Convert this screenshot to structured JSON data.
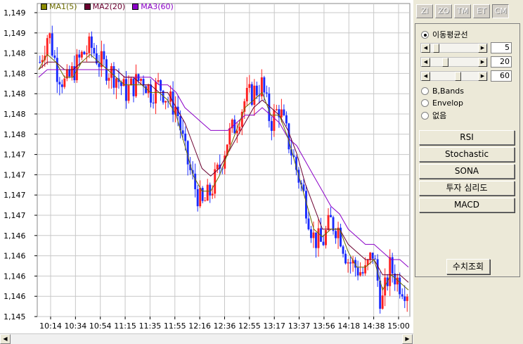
{
  "colors": {
    "up_candle": "#ff2020",
    "down_candle": "#1a2bff",
    "ma1": "#6b6b00",
    "ma2": "#6b0030",
    "ma3": "#8b00c8",
    "grid": "#c8c8c8"
  },
  "legend": [
    {
      "label": "MA1(5)",
      "color": "#8b8b00"
    },
    {
      "label": "MA2(20)",
      "color": "#6b0030"
    },
    {
      "label": "MA3(60)",
      "color": "#8b00c8"
    }
  ],
  "toolbar": {
    "buttons": [
      "ZI",
      "ZO",
      "TM",
      "ET",
      "CM"
    ],
    "active": "CM"
  },
  "settings": {
    "ma_radio_label": "이동평균선",
    "sliders": [
      {
        "value": "5",
        "position": 0.05
      },
      {
        "value": "20",
        "position": 0.28
      },
      {
        "value": "60",
        "position": 0.58
      }
    ],
    "bbands_label": "B,Bands",
    "envelop_label": "Envelop",
    "none_label": "없음",
    "indicator_buttons": [
      "RSI",
      "Stochastic",
      "SONA",
      "투자 심리도",
      "MACD"
    ],
    "query_button": "수치조회"
  },
  "chart_data": {
    "type": "candlestick",
    "y_tick_labels": [
      "1,149",
      "1,149",
      "1,148",
      "1,148",
      "1,148",
      "1,148",
      "1,148",
      "1,147",
      "1,147",
      "1,147",
      "1,147",
      "1,146",
      "1,146",
      "1,146",
      "1,146",
      "1,145"
    ],
    "x_tick_labels": [
      "10:14",
      "10:34",
      "10:54",
      "11:15",
      "11:35",
      "11:55",
      "12:16",
      "12:36",
      "12:55",
      "13:17",
      "13:37",
      "13:56",
      "14:18",
      "14:38",
      "15:00"
    ],
    "ylim": [
      1145.35,
      1149.35
    ],
    "price_path": [
      1148.7,
      1149.1,
      1148.6,
      1148.4,
      1148.6,
      1148.8,
      1148.9,
      1148.7,
      1148.6,
      1148.5,
      1148.3,
      1148.4,
      1148.5,
      1148.3,
      1148.4,
      1148.2,
      1148.1,
      1147.5,
      1147.1,
      1146.8,
      1147.0,
      1147.3,
      1147.7,
      1147.9,
      1148.2,
      1148.3,
      1148.4,
      1147.9,
      1148.1,
      1147.7,
      1147.3,
      1146.9,
      1146.4,
      1146.3,
      1146.6,
      1146.5,
      1146.1,
      1146.0,
      1145.9,
      1146.2,
      1145.5,
      1146.0,
      1145.8,
      1145.7
    ],
    "ma1": [
      1148.6,
      1148.8,
      1148.7,
      1148.5,
      1148.5,
      1148.7,
      1148.8,
      1148.7,
      1148.6,
      1148.5,
      1148.4,
      1148.4,
      1148.4,
      1148.3,
      1148.3,
      1148.2,
      1148.0,
      1147.6,
      1147.2,
      1147.0,
      1147.0,
      1147.2,
      1147.5,
      1147.8,
      1148.1,
      1148.2,
      1148.3,
      1148.0,
      1148.0,
      1147.7,
      1147.3,
      1146.9,
      1146.5,
      1146.4,
      1146.5,
      1146.5,
      1146.2,
      1146.0,
      1146.0,
      1146.1,
      1145.7,
      1145.9,
      1145.8,
      1145.7
    ],
    "ma2": [
      1148.6,
      1148.7,
      1148.7,
      1148.6,
      1148.6,
      1148.7,
      1148.7,
      1148.7,
      1148.6,
      1148.6,
      1148.5,
      1148.5,
      1148.4,
      1148.4,
      1148.3,
      1148.3,
      1148.1,
      1147.9,
      1147.6,
      1147.3,
      1147.2,
      1147.3,
      1147.5,
      1147.7,
      1147.9,
      1148.1,
      1148.2,
      1148.1,
      1148.0,
      1147.8,
      1147.5,
      1147.1,
      1146.8,
      1146.5,
      1146.5,
      1146.5,
      1146.3,
      1146.2,
      1146.1,
      1146.1,
      1145.9,
      1145.9,
      1145.9,
      1145.8
    ],
    "ma3": [
      1148.5,
      1148.6,
      1148.6,
      1148.6,
      1148.6,
      1148.6,
      1148.6,
      1148.6,
      1148.6,
      1148.6,
      1148.5,
      1148.5,
      1148.5,
      1148.5,
      1148.4,
      1148.4,
      1148.3,
      1148.1,
      1148.0,
      1147.9,
      1147.8,
      1147.8,
      1147.8,
      1147.9,
      1148.0,
      1148.0,
      1148.1,
      1148.0,
      1147.9,
      1147.7,
      1147.6,
      1147.4,
      1147.2,
      1147.0,
      1146.8,
      1146.7,
      1146.5,
      1146.4,
      1146.3,
      1146.3,
      1146.2,
      1146.1,
      1146.1,
      1146.0
    ],
    "grid": true
  }
}
